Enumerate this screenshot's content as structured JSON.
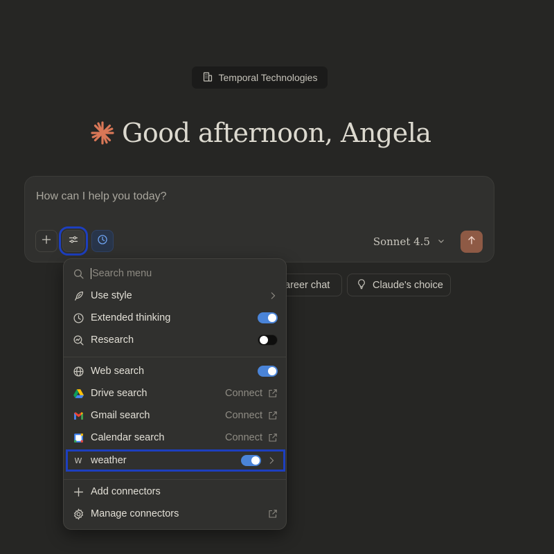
{
  "org": {
    "name": "Temporal Technologies",
    "icon": "building-icon"
  },
  "greeting": {
    "text": "Good afternoon, Angela",
    "icon": "claude-burst-icon",
    "icon_color": "#d97757"
  },
  "composer": {
    "placeholder": "How can I help you today?",
    "model": "Sonnet 4.5",
    "send_color": "#8e5a45"
  },
  "chips": [
    {
      "label": "areer chat",
      "icon": ""
    },
    {
      "label": "Claude's choice",
      "icon": "lightbulb-icon"
    }
  ],
  "menu": {
    "search_placeholder": "Search menu",
    "items": [
      {
        "label": "Use style",
        "icon": "pen-nib-icon",
        "control": "chevron"
      },
      {
        "label": "Extended thinking",
        "icon": "clock-icon",
        "control": "toggle",
        "state": "on"
      },
      {
        "label": "Research",
        "icon": "research-icon",
        "control": "toggle",
        "state": "off"
      },
      {
        "label": "Web search",
        "icon": "globe-icon",
        "control": "toggle",
        "state": "on"
      },
      {
        "label": "Drive search",
        "icon": "google-drive-icon",
        "control": "connect",
        "action": "Connect"
      },
      {
        "label": "Gmail search",
        "icon": "gmail-icon",
        "control": "connect",
        "action": "Connect"
      },
      {
        "label": "Calendar search",
        "icon": "google-calendar-icon",
        "control": "connect",
        "action": "Connect"
      },
      {
        "label": "weather",
        "icon": "W",
        "control": "toggle-chevron",
        "state": "on"
      },
      {
        "label": "Add connectors",
        "icon": "plus-icon",
        "control": "none"
      },
      {
        "label": "Manage connectors",
        "icon": "gear-icon",
        "control": "external"
      }
    ]
  },
  "colors": {
    "background": "#262624",
    "toggle_on": "#4a84d8",
    "highlight": "#1d3fbf"
  }
}
